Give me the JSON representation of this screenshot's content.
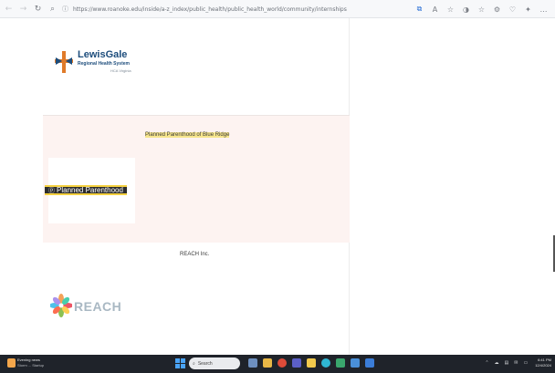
{
  "browser": {
    "url": "https://www.roanoke.edu/inside/a-z_index/public_health/public_health_world/community/internships",
    "back_icon": "←",
    "forward_icon": "→",
    "refresh_icon": "↻",
    "search_icon": "⌕",
    "lock_icon": "ⓘ",
    "toolbar_icons": [
      "⧉",
      "A",
      "☆",
      "◑",
      "☆",
      "⚙",
      "♡",
      "✦",
      "…"
    ]
  },
  "page": {
    "lewisgale": {
      "name": "LewisGale",
      "subtitle": "Regional Health System",
      "tagline": "HCA Virginia"
    },
    "planned_parenthood": {
      "title": "Planned Parenthood of Blue Ridge",
      "logo_text": "Planned Parenthood",
      "logo_icon": "ⓟ"
    },
    "reach": {
      "title": "REACH Inc.",
      "logo_text": "REACH"
    }
  },
  "taskbar": {
    "weather_line1": "Evening news",
    "weather_line2": "Storm ... Startup",
    "search_placeholder": "Search",
    "tray": [
      "⌃",
      "☁",
      "▤",
      "✉",
      "▭"
    ],
    "time": "6:41 PM",
    "date": "12/4/2024"
  },
  "colors": {
    "lewisgale_blue": "#1d4d7c",
    "pp_band": "#fdf3f1",
    "highlight_yellow": "#f6e58d",
    "taskbar_bg": "#1f232a"
  }
}
